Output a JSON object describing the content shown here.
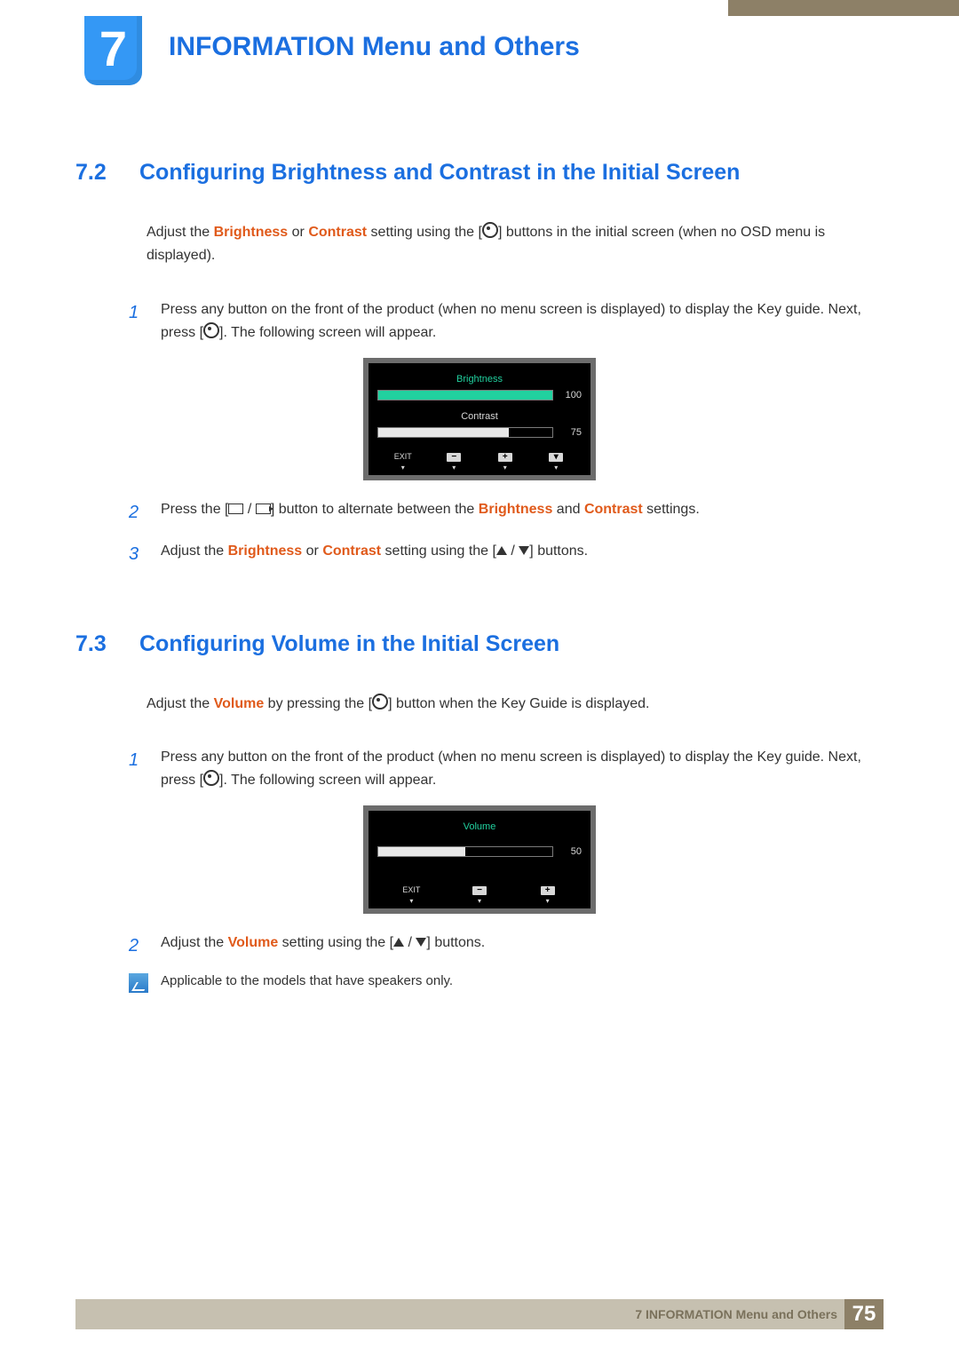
{
  "chapter": {
    "number": "7",
    "title": "INFORMATION Menu and Others"
  },
  "section1": {
    "number": "7.2",
    "title": "Configuring Brightness and Contrast in the Initial Screen",
    "intro_a": "Adjust the ",
    "intro_kw1": "Brightness",
    "intro_b": " or ",
    "intro_kw2": "Contrast",
    "intro_c": " setting using the [",
    "intro_d": "] buttons in the initial screen (when no OSD menu is displayed).",
    "step1_a": "Press any button on the front of the product (when no menu screen is displayed) to display the Key guide. Next, press [",
    "step1_b": "]. The following screen will appear.",
    "step2_a": "Press the [",
    "step2_b": "] button to alternate between the ",
    "step2_kw1": "Brightness",
    "step2_c": " and ",
    "step2_kw2": "Contrast",
    "step2_d": " settings.",
    "step3_a": "Adjust the ",
    "step3_kw1": "Brightness",
    "step3_b": " or ",
    "step3_kw2": "Contrast",
    "step3_c": " setting using the [",
    "step3_d": "] buttons.",
    "num1": "1",
    "num2": "2",
    "num3": "3"
  },
  "osd1": {
    "label1": "Brightness",
    "val1": "100",
    "fill1_pct": "100%",
    "label2": "Contrast",
    "val2": "75",
    "fill2_pct": "75%",
    "btn_exit": "EXIT"
  },
  "section2": {
    "number": "7.3",
    "title": "Configuring Volume in the Initial Screen",
    "intro_a": "Adjust the ",
    "intro_kw1": "Volume",
    "intro_b": " by pressing the [",
    "intro_c": "] button when the Key Guide is displayed.",
    "step1_a": "Press any button on the front of the product (when no menu screen is displayed) to display the Key guide. Next, press [",
    "step1_b": "]. The following screen will appear.",
    "step2_a": "Adjust the ",
    "step2_kw1": "Volume",
    "step2_b": " setting using the [",
    "step2_c": "] buttons.",
    "note": "Applicable to the models that have speakers only.",
    "num1": "1",
    "num2": "2"
  },
  "osd2": {
    "label1": "Volume",
    "val1": "50",
    "fill1_pct": "50%",
    "btn_exit": "EXIT"
  },
  "footer": {
    "text": "7 INFORMATION Menu and Others",
    "page": "75"
  }
}
